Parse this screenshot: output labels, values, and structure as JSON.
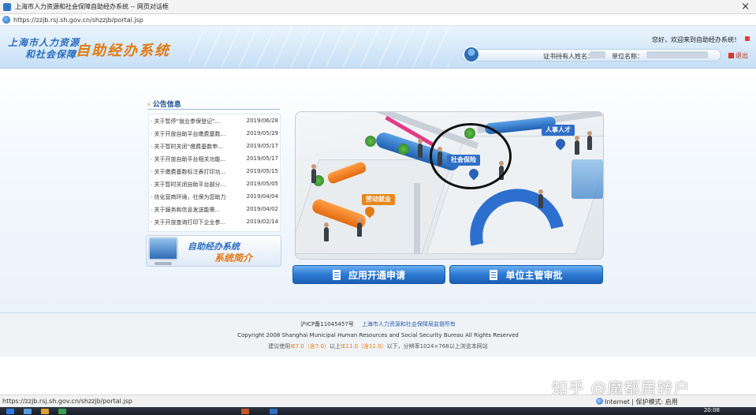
{
  "window": {
    "title": "上海市人力资源和社会保障自助经办系统 -- 网页对话框",
    "close_glyph": "×",
    "url": "https://zzjb.rsj.sh.gov.cn/shzzjb/portal.jsp"
  },
  "header": {
    "logo_line1": "上海市人力资源",
    "logo_line2": "和社会保障",
    "logo_title": "自助经办系统",
    "welcome": "您好，欢迎来到自助经办系统！",
    "cert_label": "证书持有人姓名：",
    "unit_label": "单位名称：",
    "logout": "退出"
  },
  "notices": {
    "heading": "公告信息",
    "items": [
      {
        "title": "· 关于暂停“就业参保登记”...",
        "date": "2019/06/28"
      },
      {
        "title": "· 关于开放自助平台缴费基数...",
        "date": "2019/05/29"
      },
      {
        "title": "· 关于暂时关闭“缴费基数申...",
        "date": "2019/05/17"
      },
      {
        "title": "· 关于开放自助平台相关功能...",
        "date": "2019/05/17"
      },
      {
        "title": "· 关于缴费基数标注表打印功...",
        "date": "2019/05/15"
      },
      {
        "title": "· 关于暂时关闭自助平台部分...",
        "date": "2019/05/05"
      },
      {
        "title": "· 优化营商环境，社保为您助力",
        "date": "2019/04/04"
      },
      {
        "title": "· 关于服务和信息发送能需...",
        "date": "2019/04/02"
      },
      {
        "title": "· 关于开放查询打印下企业参...",
        "date": "2019/02/14"
      }
    ]
  },
  "intro": {
    "line1": "自助经办系统",
    "line2": "系统简介"
  },
  "scene": {
    "sign_labor": "劳动就业",
    "sign_social": "社会保险",
    "sign_talent": "人事人才"
  },
  "buttons": {
    "apply": "应用开通申请",
    "approve": "单位主管审批"
  },
  "footer": {
    "icp": "沪ICP备11045457号",
    "org": "上海市人力资源和社会保障局监督所有",
    "copyright": "Copyright 2008 Shanghai Municipal Human Resources and Social Security Bureau All Rights Reserved",
    "browser_pre": "建议使用",
    "browser_hl1": "IE7.0（含7.0）",
    "browser_mid": "以上",
    "browser_hl2": "IE11.0（含11.0）",
    "browser_post": "以下，分辨率1024×768以上浏览本网站"
  },
  "watermark": "知乎 @魔都居转户",
  "statusbar": {
    "url": "https://zzjb.rsj.sh.gov.cn/shzzjb/portal.jsp",
    "zone": "Internet | 保护模式: 启用"
  },
  "taskbar": {
    "clock": "20:08"
  }
}
